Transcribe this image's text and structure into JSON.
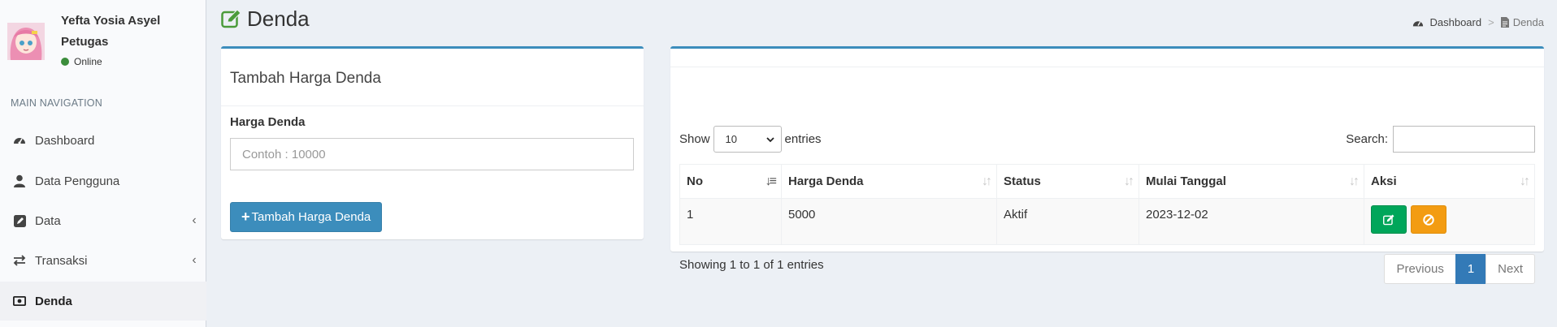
{
  "user": {
    "name": "Yefta Yosia Asyel",
    "role": "Petugas",
    "status": "Online"
  },
  "sidebar": {
    "header": "MAIN NAVIGATION",
    "items": [
      {
        "label": "Dashboard",
        "icon": "dashboard-icon"
      },
      {
        "label": "Data Pengguna",
        "icon": "user-icon"
      },
      {
        "label": "Data",
        "icon": "edit-icon"
      },
      {
        "label": "Transaksi",
        "icon": "exchange-icon"
      },
      {
        "label": "Denda",
        "icon": "money-icon"
      }
    ],
    "chevron": "‹"
  },
  "header": {
    "title": "Denda",
    "breadcrumb": {
      "home": "Dashboard",
      "separator": ">",
      "current": "Denda"
    }
  },
  "form": {
    "title": "Tambah Harga Denda",
    "field_label": "Harga Denda",
    "placeholder": "Contoh : 10000",
    "submit_label": "Tambah Harga Denda"
  },
  "table": {
    "length_prefix": "Show",
    "length_value": "10",
    "length_suffix": "entries",
    "search_label": "Search:",
    "columns": [
      "No",
      "Harga Denda",
      "Status",
      "Mulai Tanggal",
      "Aksi"
    ],
    "rows": [
      {
        "no": "1",
        "harga": "5000",
        "status": "Aktif",
        "mulai": "2023-12-02"
      }
    ],
    "info": "Showing 1 to 1 of 1 entries",
    "pagination": {
      "previous": "Previous",
      "current": "1",
      "next": "Next"
    }
  },
  "colors": {
    "primary": "#3c8dbc",
    "success": "#00a65a",
    "warning": "#f39c12",
    "online": "#3c8d3c"
  }
}
